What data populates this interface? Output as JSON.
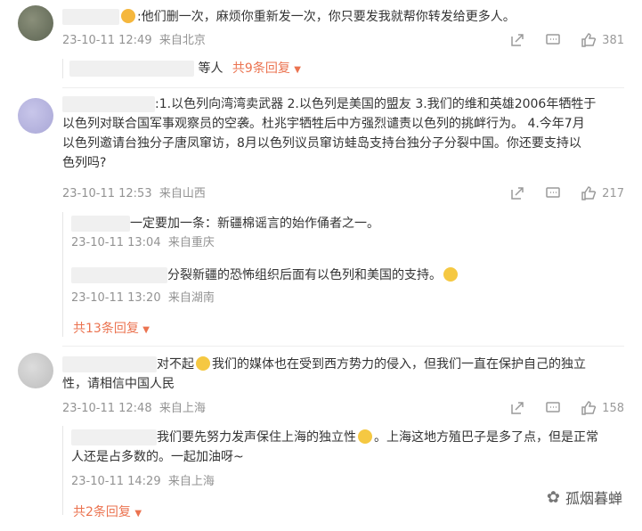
{
  "comments": [
    {
      "text": ":他们删一次，麻烦你重新发一次，你只要发我就帮你转发给更多人。",
      "time": "23-10-11 12:49",
      "location": "来自北京",
      "likes": "381",
      "reply_intro": "等人",
      "reply_link": "共9条回复"
    },
    {
      "text_line1": ":1.以色列向湾湾卖武器 2.以色列是美国的盟友 3.我们的维和英雄2006年牺牲于",
      "text_line2": "以色列对联合国军事观察员的空袭。杜兆宇牺牲后中方强烈谴责以色列的挑衅行为。  4.今年7月",
      "text_line3": "以色列邀请台独分子唐凤窜访，8月以色列议员窜访蛙岛支持台独分子分裂中国。你还要支持以",
      "text_line4": "色列吗?",
      "time": "23-10-11 12:53",
      "location": "来自山西",
      "likes": "217",
      "replies": [
        {
          "text": "一定要加一条：新疆棉谣言的始作俑者之一。",
          "time": "23-10-11 13:04",
          "location": "来自重庆"
        },
        {
          "text": "分裂新疆的恐怖组织后面有以色列和美国的支持。",
          "time": "23-10-11 13:20",
          "location": "来自湖南"
        }
      ],
      "reply_link": "共13条回复"
    },
    {
      "text_part1": "对不起",
      "text_part2": "我们的媒体也在受到西方势力的侵入，但我们一直在保护自己的独立",
      "text_line2": "性，请相信中国人民",
      "time": "23-10-11 12:48",
      "location": "来自上海",
      "likes": "158",
      "replies": [
        {
          "text_part1": "我们要先努力发声保住上海的独立性",
          "text_part2": "。上海这地方殖巴子是多了点，但是正常",
          "text_line2": "人还是占多数的。一起加油呀~",
          "time": "23-10-11 14:29",
          "location": "来自上海"
        }
      ],
      "reply_link": "共2条回复"
    }
  ],
  "watermark": "孤烟暮蝉",
  "icons": [
    "share-icon",
    "comment-icon",
    "like-icon",
    "chevron-down-icon"
  ],
  "colors": {
    "accent": "#eb7350",
    "meta": "#939393"
  }
}
